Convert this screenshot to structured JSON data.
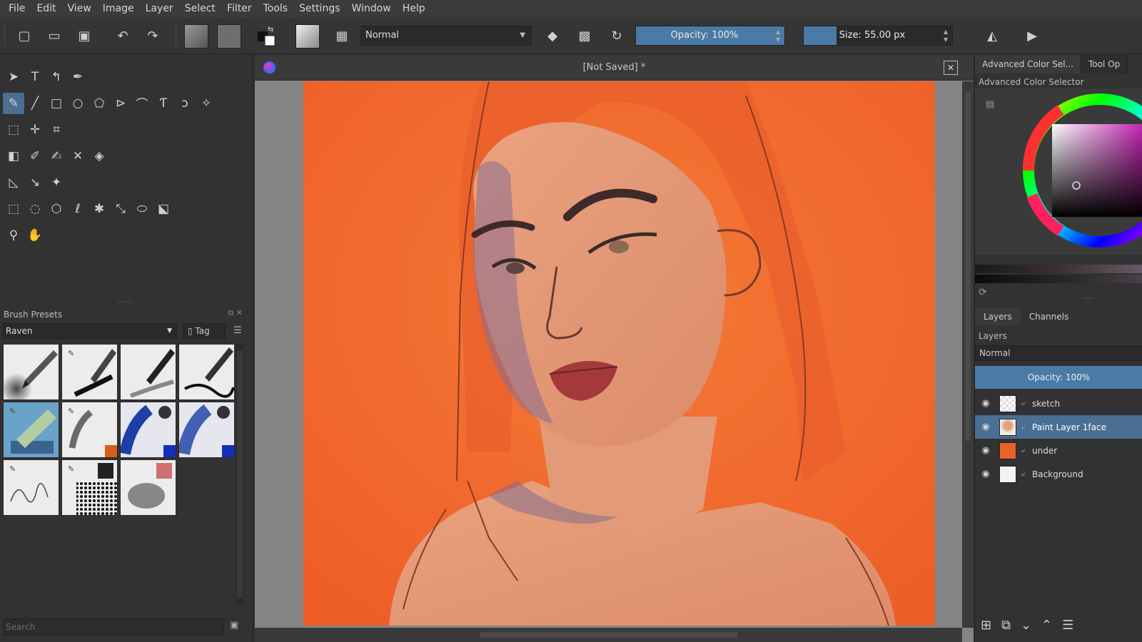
{
  "menu": [
    "File",
    "Edit",
    "View",
    "Image",
    "Layer",
    "Select",
    "Filter",
    "Tools",
    "Settings",
    "Window",
    "Help"
  ],
  "toolbar": {
    "blend_mode": "Normal",
    "opacity_label": "Opacity: 100%",
    "opacity_value": 100,
    "size_label": "Size: 55.00 px",
    "size_value": 55,
    "size_fill_fraction": 0.22
  },
  "document": {
    "title": "[Not Saved]  *"
  },
  "brush_presets": {
    "header": "Brush Presets",
    "selected_tag": "Raven",
    "tag_label": "Tag",
    "search_placeholder": "Search"
  },
  "right_dock": {
    "tabs": [
      "Advanced Color Sel...",
      "Tool Op"
    ],
    "advanced_color_title": "Advanced Color Selector"
  },
  "layers_panel": {
    "tabs": [
      "Layers",
      "Channels"
    ],
    "title": "Layers",
    "blend_mode": "Normal",
    "opacity_label": "Opacity:  100%",
    "layers": [
      {
        "name": "sketch",
        "selected": false
      },
      {
        "name": "Paint Layer 1face",
        "selected": true
      },
      {
        "name": "under",
        "selected": false
      },
      {
        "name": "Background",
        "selected": false
      }
    ]
  },
  "colors": {
    "accent": "#4a7aa6",
    "canvas_bg": "#f26b2f",
    "skin": "#e39a76"
  }
}
